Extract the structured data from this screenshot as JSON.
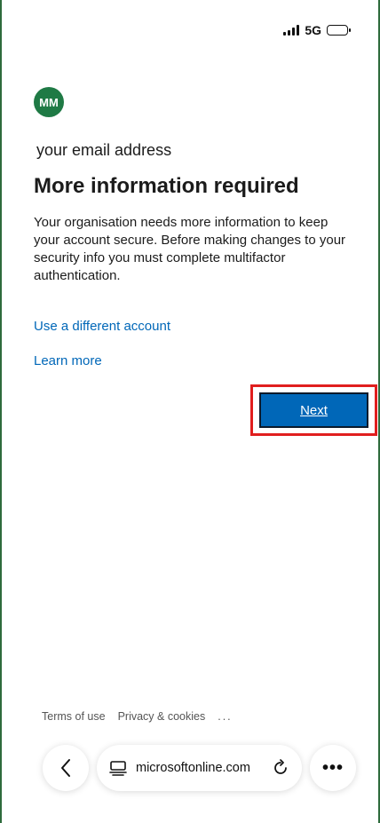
{
  "status_bar": {
    "network": "5G"
  },
  "account": {
    "initials": "MM",
    "email": "your email address"
  },
  "page": {
    "title": "More information required",
    "description": "Your organisation needs more information to keep your account secure. Before making changes to your security info you must complete multifactor authentication."
  },
  "links": {
    "different_account": "Use a different account",
    "learn_more": "Learn more"
  },
  "buttons": {
    "next": "Next"
  },
  "footer": {
    "terms": "Terms of use",
    "privacy": "Privacy & cookies",
    "more": "..."
  },
  "browser": {
    "url": "microsoftonline.com",
    "menu": "•••"
  },
  "colors": {
    "accent": "#0067b8",
    "avatar": "#1f7a45",
    "highlight": "#e01e1e",
    "frame": "#2e6b3c"
  }
}
